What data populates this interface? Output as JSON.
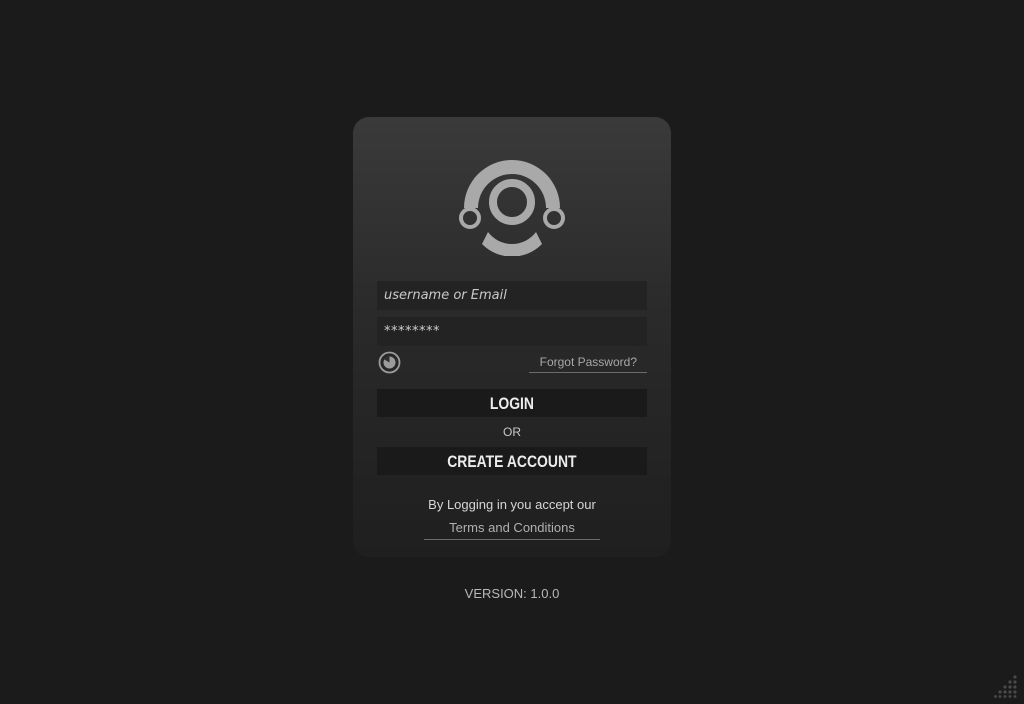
{
  "colors": {
    "background": "#1b1b1b",
    "card_top": "#3a3a3a",
    "card_bottom": "#1f1f1f",
    "logo": "#a9a9a9",
    "field_background": "#232323",
    "button_background": "#1a1a1a"
  },
  "logo": {
    "icon": "radar-eye-logo"
  },
  "login_form": {
    "username_placeholder": "username or Email",
    "password_value": "********",
    "show_password_icon": "eye-toggle-icon",
    "forgot_password_label": "Forgot Password?",
    "login_label": "LOGIN",
    "or_label": "OR",
    "create_account_label": "CREATE ACCOUNT",
    "accept_text": "By Logging in you accept our",
    "terms_label": "Terms and Conditions"
  },
  "footer": {
    "version_text": "VERSION: 1.0.0",
    "corner_icon": "resize-grip-icon"
  }
}
